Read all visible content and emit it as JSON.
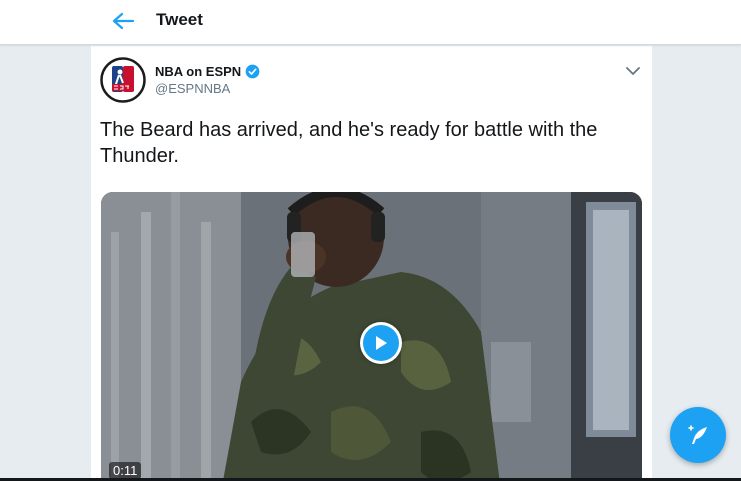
{
  "header": {
    "title": "Tweet",
    "back_icon": "arrow-left-icon"
  },
  "tweet": {
    "author_name": "NBA on ESPN",
    "author_handle": "@ESPNNBA",
    "verified": true,
    "text": "The Beard has arrived, and he's ready for battle with the Thunder.",
    "media": {
      "type": "video",
      "duration": "0:11",
      "play_icon": "play-icon"
    },
    "more_icon": "chevron-down-icon"
  },
  "fab": {
    "icon": "compose-tweet-icon"
  },
  "colors": {
    "accent": "#1da1f2",
    "background": "#e6ecf0",
    "text": "#14171a",
    "secondary_text": "#657786"
  }
}
